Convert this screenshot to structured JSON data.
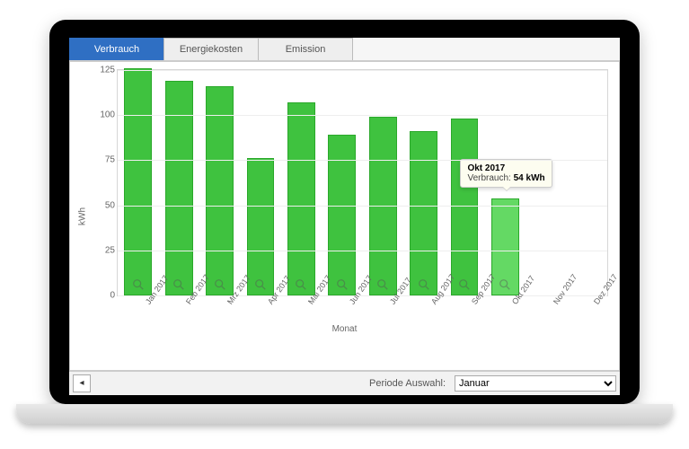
{
  "tabs": [
    {
      "id": "verbrauch",
      "label": "Verbrauch",
      "active": true
    },
    {
      "id": "energiekosten",
      "label": "Energiekosten",
      "active": false
    },
    {
      "id": "emission",
      "label": "Emission",
      "active": false
    }
  ],
  "period": {
    "label": "Periode Auswahl:",
    "value": "Januar"
  },
  "tooltip": {
    "title": "Okt 2017",
    "series_label": "Verbrauch:",
    "value_text": "54 kWh"
  },
  "chart_data": {
    "type": "bar",
    "title": "",
    "xlabel": "Monat",
    "ylabel": "kWh",
    "ylim": [
      0,
      125
    ],
    "yticks": [
      0,
      25,
      50,
      75,
      100,
      125
    ],
    "categories": [
      "Jan 2017",
      "Feb 2017",
      "Mrz 2017",
      "Apr 2017",
      "Mai 2017",
      "Jun 2017",
      "Jul 2017",
      "Aug 2017",
      "Sep 2017",
      "Okt 2017",
      "Nov 2017",
      "Dez 2017"
    ],
    "values": [
      126,
      119,
      116,
      76,
      107,
      89,
      99,
      91,
      98,
      54,
      null,
      null
    ],
    "highlight_index": 9,
    "series_name": "Verbrauch",
    "unit": "kWh"
  },
  "colors": {
    "bar": "#3fc23f",
    "bar_hi": "#64d964",
    "tab_active": "#2f6fc3"
  }
}
